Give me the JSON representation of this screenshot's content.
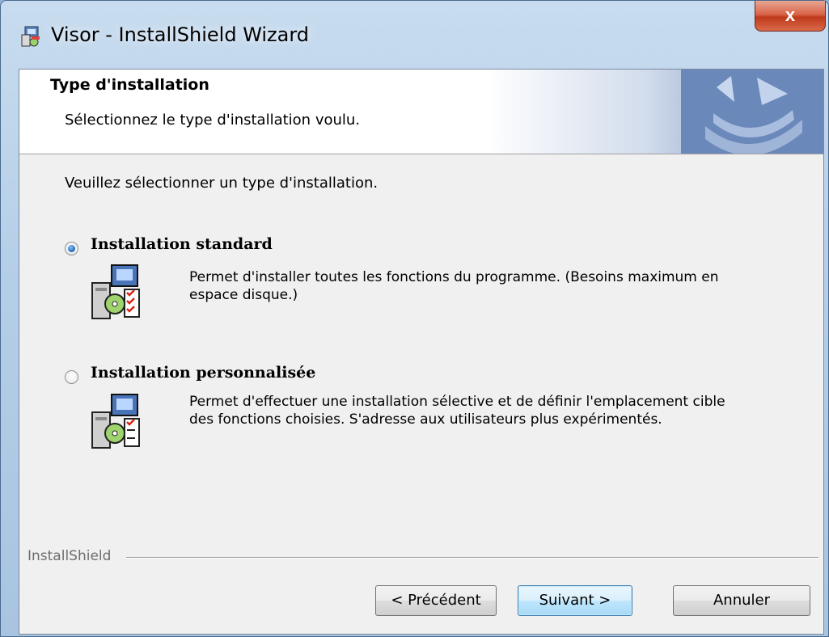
{
  "window": {
    "title": "Visor - InstallShield Wizard",
    "close_label": "x"
  },
  "banner": {
    "title": "Type d'installation",
    "subtitle": "Sélectionnez le type d'installation voulu."
  },
  "prompt": "Veuillez sélectionner un type d'installation.",
  "options": [
    {
      "label": "Installation standard",
      "selected": true,
      "description": "Permet d'installer toutes les fonctions du programme. (Besoins maximum en espace disque.)"
    },
    {
      "label": "Installation personnalisée",
      "selected": false,
      "description": "Permet d'effectuer une installation sélective et de définir l'emplacement cible des fonctions choisies. S'adresse aux utilisateurs plus expérimentés."
    }
  ],
  "brand": "InstallShield",
  "buttons": {
    "back": "< Précédent",
    "next": "Suivant >",
    "cancel": "Annuler"
  },
  "colors": {
    "dialog_bg": "#f0f0f0",
    "radio_selected": "#2b6fc2",
    "close_button": "#c8492c"
  }
}
